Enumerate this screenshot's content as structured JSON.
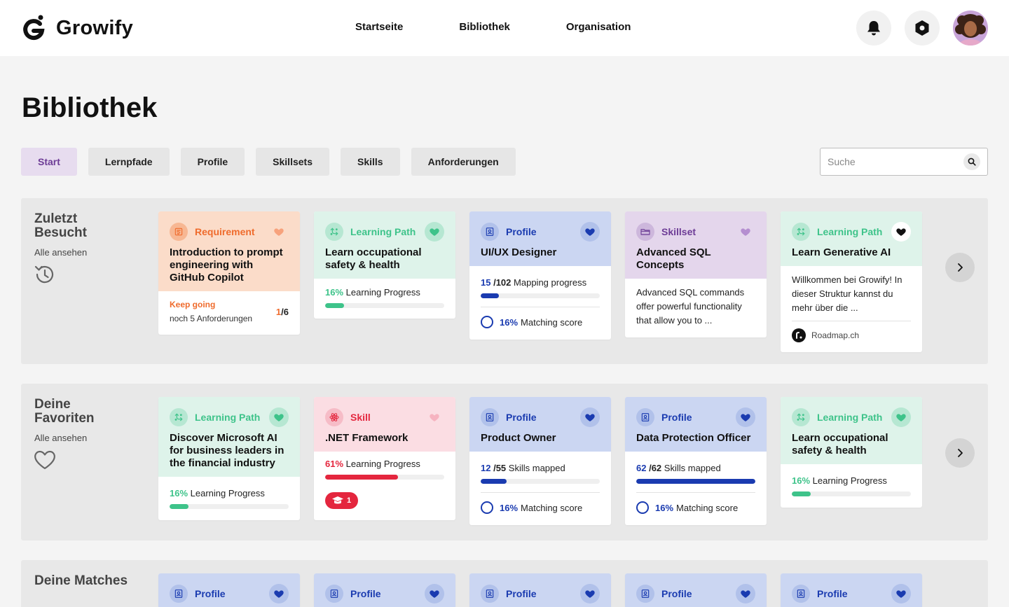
{
  "app": {
    "name": "Growify"
  },
  "nav": [
    {
      "label": "Startseite"
    },
    {
      "label": "Bibliothek"
    },
    {
      "label": "Organisation"
    }
  ],
  "header_icons": {
    "notifications": "bell-icon",
    "settings": "hexagon-icon",
    "avatar": "user-avatar"
  },
  "page": {
    "title": "Bibliothek"
  },
  "tabs": [
    {
      "label": "Start",
      "active": true
    },
    {
      "label": "Lernpfade"
    },
    {
      "label": "Profile"
    },
    {
      "label": "Skillsets"
    },
    {
      "label": "Skills"
    },
    {
      "label": "Anforderungen"
    }
  ],
  "search": {
    "placeholder": "Suche"
  },
  "colors": {
    "requirement": "#ef6b2c",
    "learning_path": "#3ec38a",
    "profile": "#1a3bb0",
    "skillset": "#6d3c96",
    "skill": "#e4263e"
  },
  "sections": {
    "recent": {
      "title": "Zuletzt Besucht",
      "link": "Alle ansehen",
      "cards": [
        {
          "type": "Requirement",
          "title": "Introduction to prompt engineering with GitHub Copilot",
          "status": "Keep going",
          "detail": "noch 5 Anforderungen",
          "count_done": "1",
          "count_total": "/6"
        },
        {
          "type": "Learning Path",
          "title": "Learn occupational safety & health",
          "progress_pct": "16%",
          "progress_label": "Learning Progress",
          "progress": 0.16
        },
        {
          "type": "Profile",
          "title": "UI/UX Designer",
          "mapped": "15",
          "total": "/102",
          "mapped_label": "Mapping progress",
          "progress": 0.15,
          "match_pct": "16%",
          "match_label": "Matching score"
        },
        {
          "type": "Skillset",
          "title": "Advanced SQL Concepts",
          "description": "Advanced SQL commands offer powerful functionality that allow you to ..."
        },
        {
          "type": "Learning Path",
          "title": "Learn Generative AI",
          "description": "Willkommen bei Growify! In dieser Struktur kannst du mehr über die ...",
          "source": "Roadmap.ch"
        }
      ]
    },
    "favorites": {
      "title": "Deine Favoriten",
      "link": "Alle ansehen",
      "cards": [
        {
          "type": "Learning Path",
          "title": "Discover Microsoft AI for business leaders in the financial industry",
          "progress_pct": "16%",
          "progress_label": "Learning Progress",
          "progress": 0.16
        },
        {
          "type": "Skill",
          "title": ".NET Framework",
          "progress_pct": "61%",
          "progress_label": "Learning Progress",
          "progress": 0.61,
          "badge": "1"
        },
        {
          "type": "Profile",
          "title": "Product Owner",
          "mapped": "12",
          "total": "/55",
          "mapped_label": "Skills mapped",
          "progress": 0.22,
          "match_pct": "16%",
          "match_label": "Matching score"
        },
        {
          "type": "Profile",
          "title": "Data Protection Officer",
          "mapped": "62",
          "total": "/62",
          "mapped_label": "Skills mapped",
          "progress": 1.0,
          "match_pct": "16%",
          "match_label": "Matching score"
        },
        {
          "type": "Learning Path",
          "title": "Learn occupational safety & health",
          "progress_pct": "16%",
          "progress_label": "Learning Progress",
          "progress": 0.16
        }
      ]
    },
    "matches": {
      "title": "Deine Matches",
      "cards": [
        {
          "type": "Profile"
        },
        {
          "type": "Profile"
        },
        {
          "type": "Profile"
        },
        {
          "type": "Profile"
        },
        {
          "type": "Profile"
        }
      ]
    }
  }
}
